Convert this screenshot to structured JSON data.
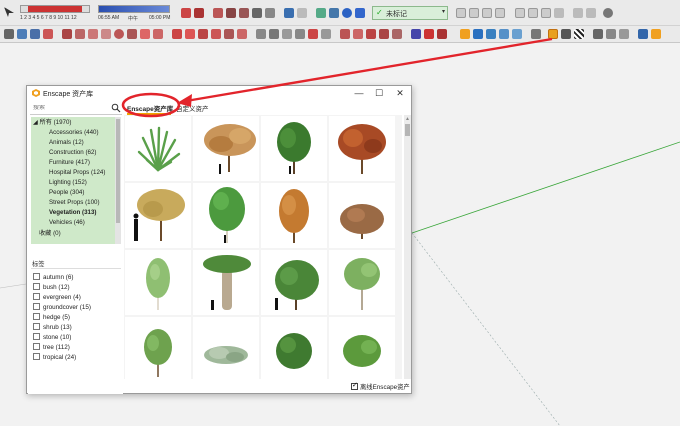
{
  "toolbar": {
    "scale_numbers": "1 2 3 4 5 6 7 8 9 10 11 12",
    "time_start": "06:55 AM",
    "time_mid": "中午",
    "time_end": "05:00 PM",
    "tag_combo": "未标记"
  },
  "dialog": {
    "title": "Enscape 资产库",
    "minimize": "—",
    "maximize": "☐",
    "close": "✕",
    "search_placeholder": "搜索",
    "tabs": {
      "enscape": "Enscape资产库",
      "custom": "自定义资产"
    },
    "categories": {
      "all": "所有 (1970)",
      "items": [
        "Accessories (440)",
        "Animals (12)",
        "Construction (62)",
        "Furniture (417)",
        "Hospital Props (124)",
        "Lighting (152)",
        "People (304)",
        "Street Props (100)",
        "Vegetation (313)",
        "Vehicles (46)"
      ],
      "favorites": "收藏 (0)"
    },
    "tags_header": "标签",
    "tags": [
      "autumn (6)",
      "bush (12)",
      "evergreen (4)",
      "groundcover (15)",
      "hedge (5)",
      "shrub (13)",
      "stone (10)",
      "tree (112)",
      "tropical (24)"
    ],
    "offline_label": "离线Enscape资产"
  },
  "colors": {
    "tab_underline": "#f0a500",
    "tree_bg": "#cfe9c9",
    "annotation": "#e2242b",
    "axis_green": "#3aa63a"
  }
}
